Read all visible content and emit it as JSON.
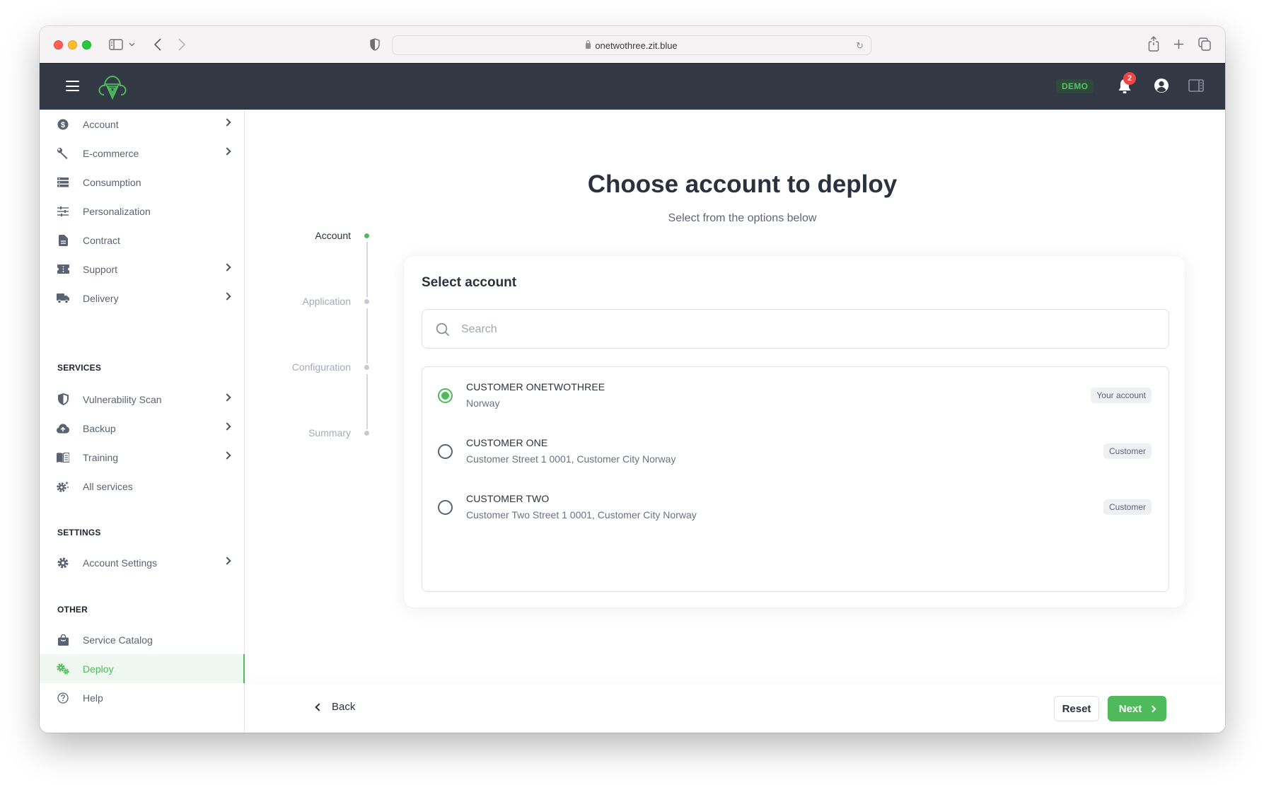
{
  "browser": {
    "url": "onetwothree.zit.blue"
  },
  "header": {
    "badge": "DEMO",
    "notification_count": "2",
    "colors": {
      "header_bg": "#323844",
      "accent": "#4fba5c",
      "notification": "#ee4444"
    }
  },
  "sidebar": {
    "main_items": [
      {
        "label": "Account",
        "icon": "dollar-circle-icon",
        "has_submenu": true
      },
      {
        "label": "E-commerce",
        "icon": "wrench-icon",
        "has_submenu": true
      },
      {
        "label": "Consumption",
        "icon": "list-icon",
        "has_submenu": false
      },
      {
        "label": "Personalization",
        "icon": "sliders-icon",
        "has_submenu": false
      },
      {
        "label": "Contract",
        "icon": "document-icon",
        "has_submenu": false
      },
      {
        "label": "Support",
        "icon": "ticket-icon",
        "has_submenu": true
      },
      {
        "label": "Delivery",
        "icon": "truck-icon",
        "has_submenu": true
      }
    ],
    "services_title": "SERVICES",
    "services_items": [
      {
        "label": "Vulnerability Scan",
        "icon": "shield-icon",
        "has_submenu": true
      },
      {
        "label": "Backup",
        "icon": "cloud-upload-icon",
        "has_submenu": true
      },
      {
        "label": "Training",
        "icon": "book-icon",
        "has_submenu": true
      },
      {
        "label": "All services",
        "icon": "cog-sparkle-icon",
        "has_submenu": false
      }
    ],
    "settings_title": "SETTINGS",
    "settings_items": [
      {
        "label": "Account Settings",
        "icon": "gear-icon",
        "has_submenu": true
      }
    ],
    "other_title": "OTHER",
    "other_items": [
      {
        "label": "Service Catalog",
        "icon": "shopping-bag-icon",
        "has_submenu": false
      },
      {
        "label": "Deploy",
        "icon": "cogs-icon",
        "has_submenu": false,
        "active": true
      },
      {
        "label": "Help",
        "icon": "question-circle-icon",
        "has_submenu": false
      }
    ]
  },
  "main": {
    "title": "Choose account to deploy",
    "subtitle": "Select from the options below",
    "steps": [
      {
        "label": "Account",
        "active": true
      },
      {
        "label": "Application",
        "active": false
      },
      {
        "label": "Configuration",
        "active": false
      },
      {
        "label": "Summary",
        "active": false
      }
    ],
    "card": {
      "title": "Select account",
      "search_placeholder": "Search",
      "search_value": "",
      "accounts": [
        {
          "name": "CUSTOMER ONETWOTHREE",
          "address": "Norway",
          "tag": "Your account",
          "selected": true
        },
        {
          "name": "CUSTOMER ONE",
          "address": "Customer Street 1 0001, Customer City Norway",
          "tag": "Customer",
          "selected": false
        },
        {
          "name": "CUSTOMER TWO",
          "address": "Customer Two Street 1 0001, Customer City Norway",
          "tag": "Customer",
          "selected": false
        }
      ]
    },
    "footer": {
      "back_label": "Back",
      "reset_label": "Reset",
      "next_label": "Next"
    }
  }
}
